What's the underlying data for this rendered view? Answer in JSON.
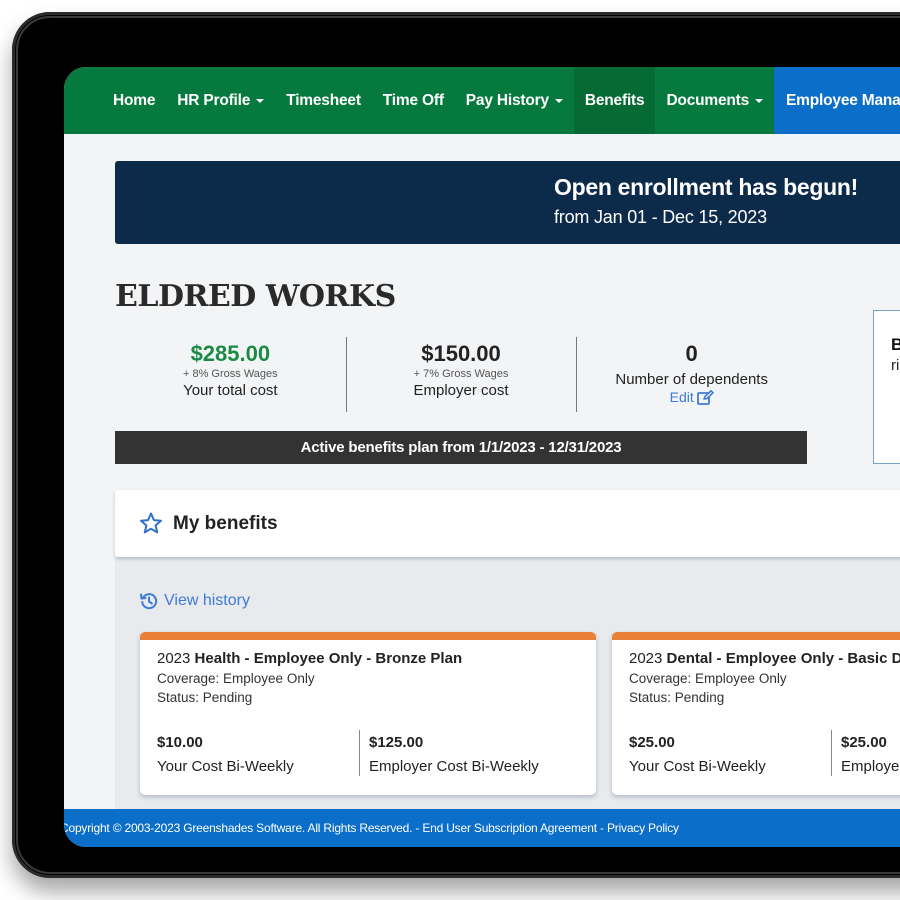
{
  "nav": {
    "items": [
      {
        "label": "Home",
        "dropdown": false
      },
      {
        "label": "HR Profile",
        "dropdown": true
      },
      {
        "label": "Timesheet",
        "dropdown": false
      },
      {
        "label": "Time Off",
        "dropdown": false
      },
      {
        "label": "Pay History",
        "dropdown": true
      },
      {
        "label": "Benefits",
        "dropdown": false,
        "active": true
      },
      {
        "label": "Documents",
        "dropdown": true
      },
      {
        "label": "Employee Manage",
        "dropdown": false
      }
    ]
  },
  "banner": {
    "title": "Open enrollment has begun!",
    "subtitle": "from Jan 01 - Dec 15, 2023"
  },
  "company": {
    "name": "ELDRED WORKS"
  },
  "stats": {
    "your_cost": {
      "value": "$285.00",
      "note": "+ 8% Gross Wages",
      "label": "Your total cost"
    },
    "employer_cost": {
      "value": "$150.00",
      "note": "+ 7% Gross Wages",
      "label": "Employer cost"
    },
    "dependents": {
      "value": "0",
      "label": "Number of dependents",
      "edit_label": "Edit"
    }
  },
  "active_plan": "Active benefits plan from 1/1/2023 - 12/31/2023",
  "side_panel": {
    "title": "Big",
    "subtitle": "righ"
  },
  "benefits": {
    "title": "My benefits",
    "view_history": "View history",
    "cards": [
      {
        "year": "2023",
        "title": "Health - Employee Only - Bronze Plan",
        "coverage": "Coverage: Employee Only",
        "status": "Status: Pending",
        "your_cost": "$10.00",
        "your_cost_label": "Your Cost Bi-Weekly",
        "employer_cost": "$125.00",
        "employer_cost_label": "Employer Cost Bi-Weekly"
      },
      {
        "year": "2023",
        "title": "Dental - Employee Only - Basic Den",
        "coverage": "Coverage: Employee Only",
        "status": "Status: Pending",
        "your_cost": "$25.00",
        "your_cost_label": "Your Cost Bi-Weekly",
        "employer_cost": "$25.00",
        "employer_cost_label": "Employer"
      }
    ]
  },
  "footer": {
    "copyright": "Copyright © 2003-2023 Greenshades Software. All Rights Reserved.",
    "sep1": " - ",
    "eula": "End User Subscription Agreement",
    "sep2": " - ",
    "privacy": "Privacy Policy"
  },
  "colors": {
    "nav_green": "#067a3e",
    "nav_active": "#066a35",
    "nav_blue": "#0b6ec8",
    "banner_navy": "#0c2a4a",
    "accent_orange": "#e8803a",
    "cost_green": "#1a8a45",
    "link_blue": "#3d7bd6"
  }
}
